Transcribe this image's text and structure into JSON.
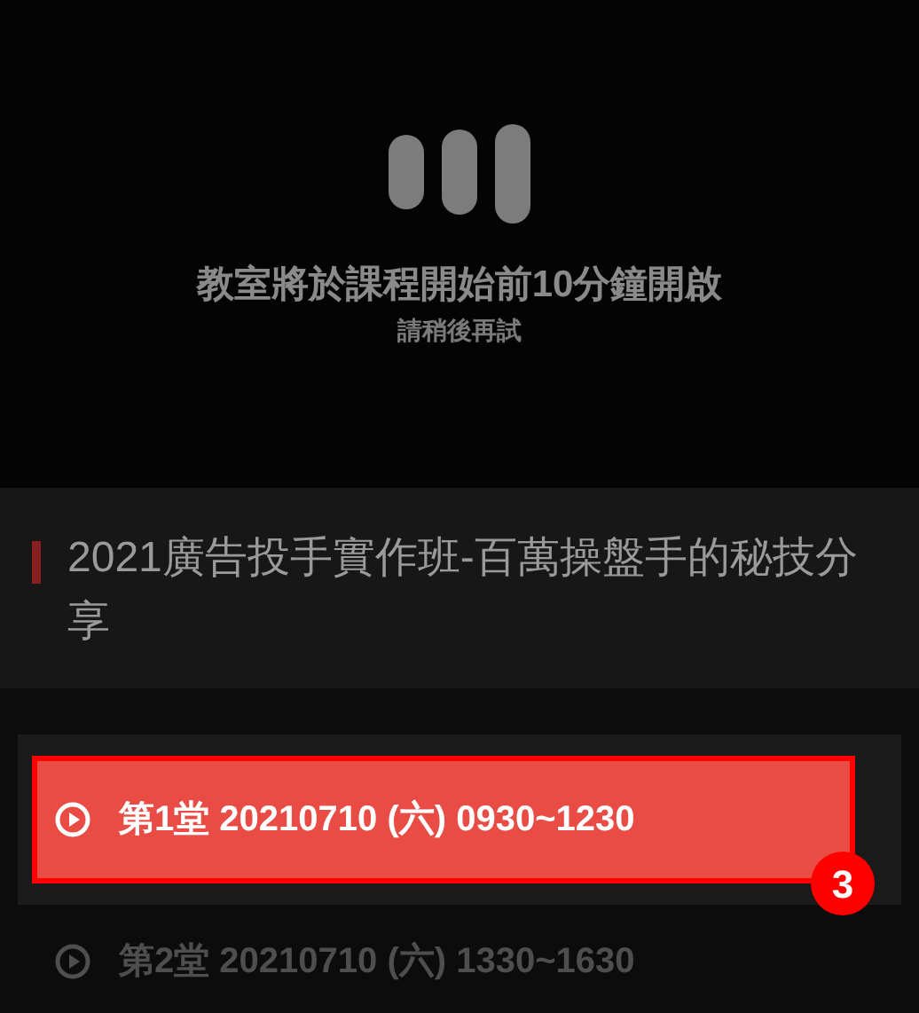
{
  "player": {
    "message": "教室將於課程開始前10分鐘開啟",
    "hint": "請稍後再試"
  },
  "course": {
    "title": "2021廣告投手實作班-百萬操盤手的秘技分享"
  },
  "lessons": [
    {
      "label": "第1堂 20210710 (六) 0930~1230",
      "selected": true,
      "badge": "3"
    },
    {
      "label": "第2堂 20210710 (六) 1330~1630",
      "selected": false
    }
  ]
}
